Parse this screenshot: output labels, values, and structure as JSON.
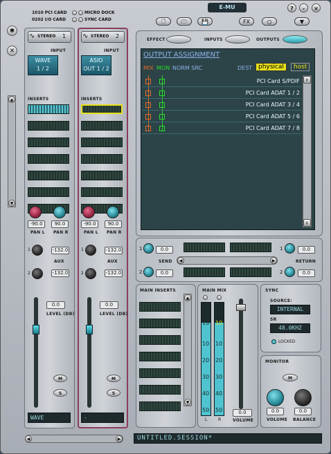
{
  "header": {
    "pci_card": "1010 PCI CARD",
    "io_card": "0202 I/O CARD",
    "micro_dock": "MICRO DOCK",
    "sync_card": "SYNC CARD",
    "brand": "E-MU",
    "fx_label": "FX",
    "help": "?",
    "minimize": "-",
    "close": "×"
  },
  "side": {
    "star": "✱",
    "x": "✕"
  },
  "strips": [
    {
      "title": "STEREO",
      "number": "1",
      "input_label": "INPUT",
      "input_line1": "WAVE",
      "input_line2": "1 / 2",
      "inserts_label": "INSERTS",
      "pan_l": "-90.0",
      "pan_r": "90.0",
      "pan_l_label": "PAN L",
      "pan_r_label": "PAN R",
      "aux_label": "AUX",
      "aux1_num": "1",
      "aux2_num": "2",
      "aux1": "-132.0",
      "aux2": "-132.0",
      "level": "0.0",
      "level_label": "LEVEL (DB)",
      "mute": "M",
      "solo": "S",
      "name": "WAVE"
    },
    {
      "title": "STEREO",
      "number": "2",
      "input_label": "INPUT",
      "input_line1": "ASIO",
      "input_line2": "OUT 1 / 2",
      "inserts_label": "INSERTS",
      "pan_l": "-90.0",
      "pan_r": "90.0",
      "pan_l_label": "PAN L",
      "pan_r_label": "PAN R",
      "aux_label": "AUX",
      "aux1_num": "1",
      "aux2_num": "2",
      "aux1": "-132.0",
      "aux2": "-132.0",
      "level": "0.0",
      "level_label": "LEVEL (DB)",
      "mute": "M",
      "solo": "S",
      "name": "-"
    }
  ],
  "tabs": {
    "effect": "EFFECT",
    "inputs": "INPUTS",
    "outputs": "OUTPUTS"
  },
  "output": {
    "title": "OUTPUT ASSIGNMENT",
    "mix": "MIX",
    "mon": "MON",
    "norm_src": "NORM SRC",
    "dest": "DEST",
    "physical": "physical",
    "host": "host",
    "rows": [
      "PCI Card S/PDIF",
      "PCI Card ADAT 1 / 2",
      "PCI Card ADAT 3 / 4",
      "PCI Card ADAT 5 / 6",
      "PCI Card ADAT 7 / 8"
    ]
  },
  "send": {
    "label": "SEND",
    "v1": "0.0",
    "v2": "0.0",
    "n1": "1",
    "n2": "2"
  },
  "ret": {
    "label": "RETURN",
    "v1": "0.0",
    "v2": "0.0",
    "n1": "1",
    "n2": "2"
  },
  "main_inserts": {
    "label": "MAIN INSERTS"
  },
  "main_mix": {
    "label": "MAIN MIX",
    "top": "10",
    "ticks": [
      "10",
      "20",
      "30",
      "40",
      "50"
    ],
    "l": "L",
    "r": "R",
    "volume_value": "0.0",
    "volume_label": "VOLUME"
  },
  "sync": {
    "label": "SYNC",
    "source_label": "SOURCE:",
    "source": "INTERNAL",
    "sr_label": "SR",
    "sr": "48.0KHZ",
    "locked": "LOCKED"
  },
  "monitor": {
    "label": "MONITOR",
    "mute": "M",
    "volume_value": "0.0",
    "balance_value": "0.0",
    "volume_label": "VOLUME",
    "balance_label": "BALANCE"
  },
  "session": {
    "name": "UNTITLED.SESSION*"
  },
  "colors": {
    "accent": "#4fc3d0",
    "yellow": "#e8e01a",
    "mix": "#e06a2a",
    "mon": "#2adb2a"
  }
}
